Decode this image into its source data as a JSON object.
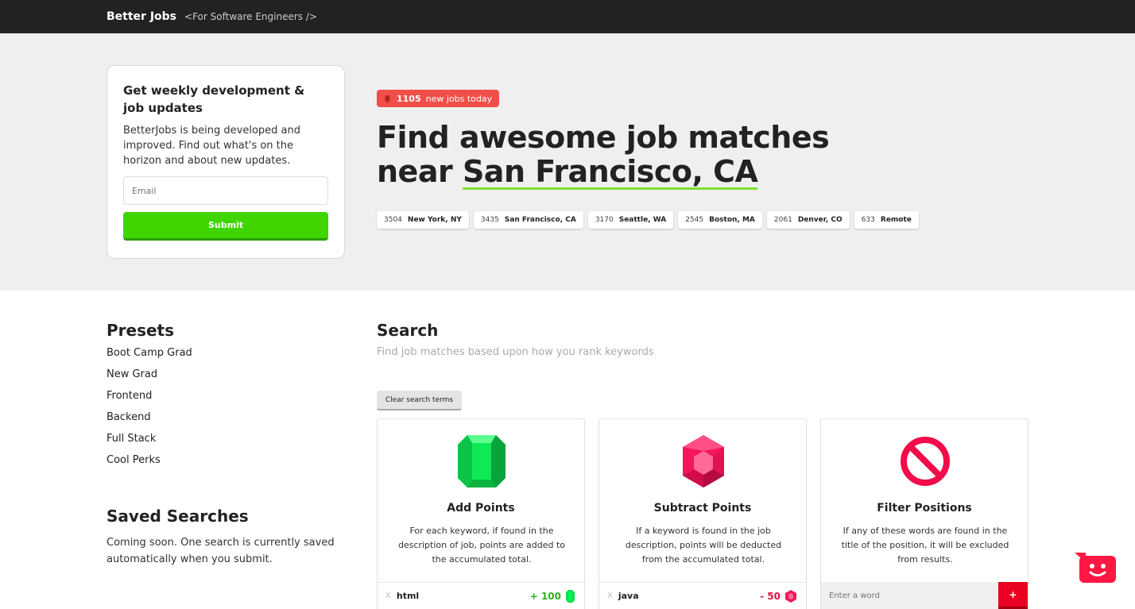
{
  "header": {
    "brand": "Better Jobs",
    "tagline": "<For Software Engineers />"
  },
  "newsletter": {
    "title": "Get weekly development & job updates",
    "description": "BetterJobs is being developed and improved. Find out what's on the horizon and about new updates.",
    "email_placeholder": "Email",
    "submit_label": "Submit"
  },
  "hero": {
    "badge_count": "1105",
    "badge_text": "new jobs today",
    "headline_line1": "Find awesome job matches",
    "headline_near": "near ",
    "headline_city": "San Francisco, CA",
    "cities": [
      {
        "count": "3504",
        "name": "New York, NY"
      },
      {
        "count": "3435",
        "name": "San Francisco, CA"
      },
      {
        "count": "3170",
        "name": "Seattle, WA"
      },
      {
        "count": "2545",
        "name": "Boston, MA"
      },
      {
        "count": "2061",
        "name": "Denver, CO"
      },
      {
        "count": "633",
        "name": "Remote"
      }
    ]
  },
  "presets": {
    "title": "Presets",
    "items": [
      "Boot Camp Grad",
      "New Grad",
      "Frontend",
      "Backend",
      "Full Stack",
      "Cool Perks"
    ]
  },
  "saved": {
    "title": "Saved Searches",
    "text": "Coming soon. One search is currently saved automatically when you submit."
  },
  "search": {
    "title": "Search",
    "subtitle": "Find job matches based upon how you rank keywords",
    "clear_label": "Clear search terms",
    "cards": {
      "add": {
        "icon": "green-gem-icon",
        "title": "Add Points",
        "description": "For each keyword, if found in the description of job, points are added to the accumulated total.",
        "remove_label": "X",
        "keyword": "html",
        "points": "+ 100"
      },
      "subtract": {
        "icon": "red-gem-icon",
        "title": "Subtract Points",
        "description": "If a keyword is found in the job description, points will be deducted from the accumulated total.",
        "remove_label": "X",
        "keyword": "java",
        "points": "- 50"
      },
      "filter": {
        "icon": "prohibited-icon",
        "title": "Filter Positions",
        "description": "If any of these words are found in the title of the position, it will be excluded from results.",
        "input_placeholder": "Enter a word",
        "add_label": "+"
      }
    }
  },
  "colors": {
    "topbar": "#222222",
    "hero_bg": "#efefef",
    "submit_green": "#3fd600",
    "badge_red": "#f24e49",
    "underline_green": "#7fe22d",
    "add_green": "#2bb01e",
    "subtract_red": "#e0123f",
    "filter_red": "#ea0020"
  }
}
